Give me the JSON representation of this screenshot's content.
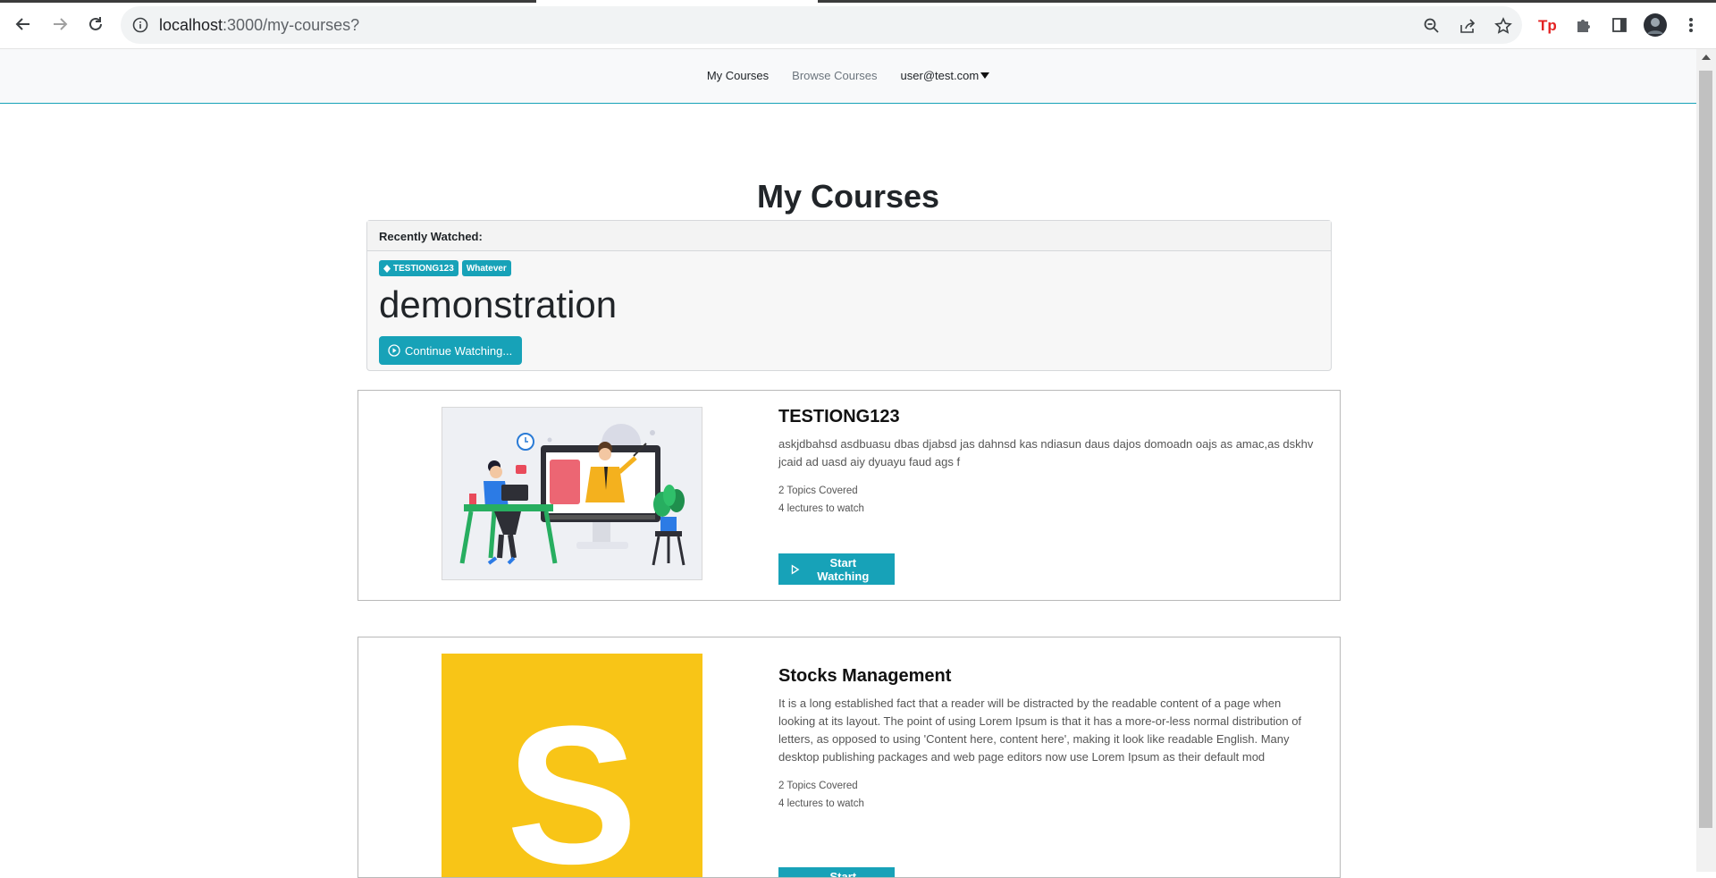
{
  "browser": {
    "url_host": "localhost",
    "url_rest": ":3000/my-courses?",
    "icons": [
      "back-icon",
      "forward-icon",
      "reload-icon",
      "info-icon",
      "zoom-icon",
      "share-icon",
      "star-icon",
      "tp-extension-icon",
      "puzzle-icon",
      "sidepanel-icon",
      "profile-avatar",
      "kebab-menu-icon"
    ]
  },
  "nav": {
    "links": [
      {
        "label": "My Courses",
        "active": true
      },
      {
        "label": "Browse Courses",
        "active": false
      }
    ],
    "user": "user@test.com"
  },
  "page": {
    "title": "My Courses"
  },
  "recent": {
    "header": "Recently Watched:",
    "badges": [
      "TESTIONG123",
      "Whatever"
    ],
    "lesson": "demonstration",
    "button": "Continue Watching..."
  },
  "courses": [
    {
      "title": "TESTIONG123",
      "description": "askjdbahsd asdbuasu dbas djabsd jas dahnsd kas ndiasun daus dajos domoadn oajs as amac,as dskhv jcaid ad uasd aiy dyuayu faud ags f",
      "topics": "2 Topics Covered",
      "lectures": "4 lectures to watch",
      "button": "Start Watching",
      "thumb": "illustration"
    },
    {
      "title": "Stocks Management",
      "description": "It is a long established fact that a reader will be distracted by the readable content of a page when looking at its layout. The point of using Lorem Ipsum is that it has a more-or-less normal distribution of letters, as opposed to using 'Content here, content here', making it look like readable English. Many desktop publishing packages and web page editors now use Lorem Ipsum as their default mod",
      "topics": "2 Topics Covered",
      "lectures": "4 lectures to watch",
      "button": "Start Watching",
      "thumb_letter": "S",
      "thumb_color": "#f8c517"
    }
  ],
  "colors": {
    "accent": "#17a2b8",
    "nav_bg": "#f8f9fa"
  }
}
